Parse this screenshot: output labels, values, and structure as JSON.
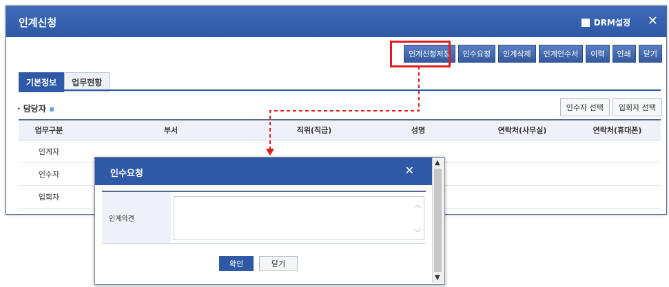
{
  "window": {
    "title": "인계신청",
    "drm_label": "DRM설정",
    "close": "✕"
  },
  "toolbar": [
    "인계신청저장",
    "인수요청",
    "인계삭제",
    "인계인수서",
    "이력",
    "인쇄",
    "닫기"
  ],
  "tabs": [
    "기본정보",
    "업무현황"
  ],
  "section": {
    "title": "담당자"
  },
  "select_buttons": [
    "인수자 선택",
    "입회자 선택"
  ],
  "table": {
    "headers": [
      "업무구분",
      "부서",
      "직위(직급)",
      "성명",
      "연락처(사무실)",
      "연락처(휴대폰)"
    ],
    "rows": [
      [
        "인계자"
      ],
      [
        "인수자"
      ],
      [
        "입회자"
      ]
    ]
  },
  "modal": {
    "title": "인수요청",
    "close": "✕",
    "label": "인계의견",
    "confirm": "확인",
    "cancel": "닫기"
  },
  "colors": {
    "primary": "#2f59a6",
    "highlight": "#e01b1b"
  }
}
